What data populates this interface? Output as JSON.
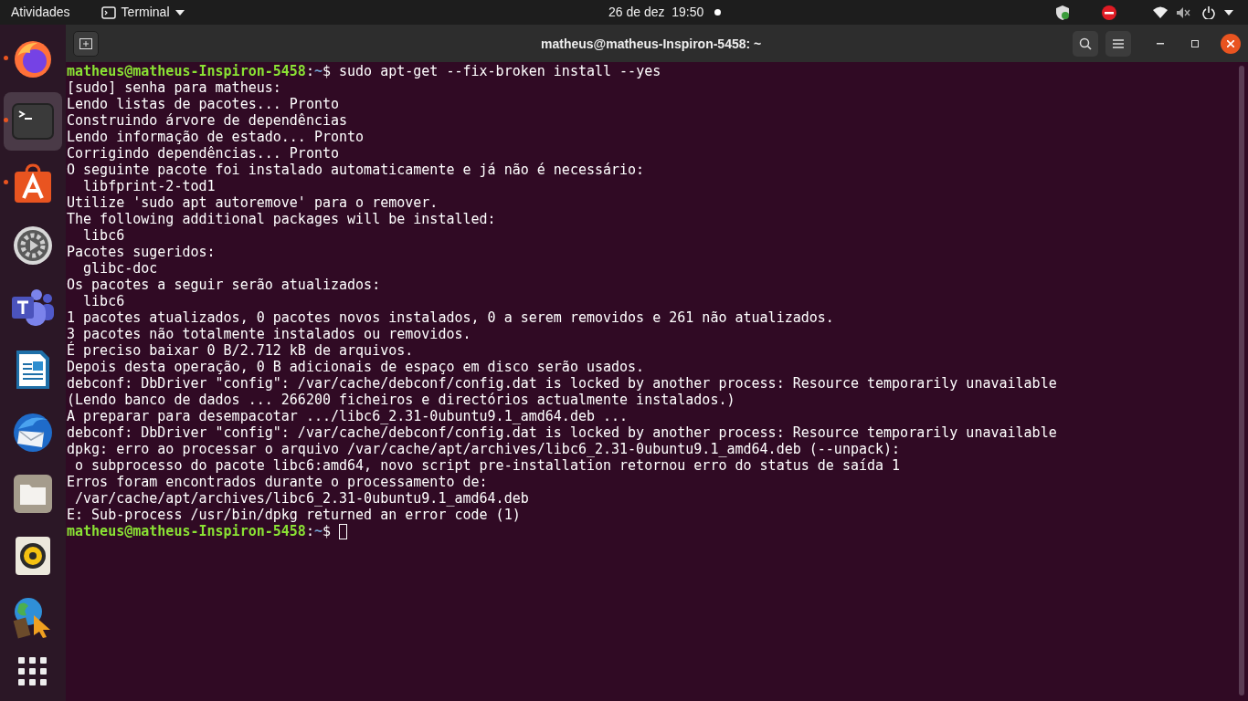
{
  "top_bar": {
    "activities": "Atividades",
    "app_menu": "Terminal",
    "clock": "26 de dez  19:50",
    "notification_dot": true
  },
  "dock": {
    "items": [
      {
        "kind": "firefox",
        "running": true,
        "selected": false
      },
      {
        "kind": "terminal",
        "running": true,
        "selected": true
      },
      {
        "kind": "store",
        "running": true,
        "selected": false
      },
      {
        "kind": "settings",
        "running": false,
        "selected": false
      },
      {
        "kind": "teams",
        "running": false,
        "selected": false
      },
      {
        "kind": "writer",
        "running": false,
        "selected": false
      },
      {
        "kind": "mail",
        "running": false,
        "selected": false
      },
      {
        "kind": "files",
        "running": false,
        "selected": false
      },
      {
        "kind": "speaker",
        "running": false,
        "selected": false
      },
      {
        "kind": "globe",
        "running": false,
        "selected": false
      }
    ]
  },
  "window": {
    "title": "matheus@matheus-Inspiron-5458: ~"
  },
  "terminal": {
    "lines": [
      {
        "kind": "prompt",
        "user": "matheus@matheus-Inspiron-5458",
        "sep": ":",
        "path": "~",
        "symbol": "$",
        "command": " sudo apt-get --fix-broken install --yes",
        "cursor": false
      },
      {
        "kind": "output",
        "text": "[sudo] senha para matheus:"
      },
      {
        "kind": "output",
        "text": "Lendo listas de pacotes... Pronto"
      },
      {
        "kind": "output",
        "text": "Construindo árvore de dependências"
      },
      {
        "kind": "output",
        "text": "Lendo informação de estado... Pronto"
      },
      {
        "kind": "output",
        "text": "Corrigindo dependências... Pronto"
      },
      {
        "kind": "output",
        "text": "O seguinte pacote foi instalado automaticamente e já não é necessário:"
      },
      {
        "kind": "output",
        "text": "  libfprint-2-tod1"
      },
      {
        "kind": "output",
        "text": "Utilize 'sudo apt autoremove' para o remover."
      },
      {
        "kind": "output",
        "text": "The following additional packages will be installed:"
      },
      {
        "kind": "output",
        "text": "  libc6"
      },
      {
        "kind": "output",
        "text": "Pacotes sugeridos:"
      },
      {
        "kind": "output",
        "text": "  glibc-doc"
      },
      {
        "kind": "output",
        "text": "Os pacotes a seguir serão atualizados:"
      },
      {
        "kind": "output",
        "text": "  libc6"
      },
      {
        "kind": "output",
        "text": "1 pacotes atualizados, 0 pacotes novos instalados, 0 a serem removidos e 261 não atualizados."
      },
      {
        "kind": "output",
        "text": "3 pacotes não totalmente instalados ou removidos."
      },
      {
        "kind": "output",
        "text": "É preciso baixar 0 B/2.712 kB de arquivos."
      },
      {
        "kind": "output",
        "text": "Depois desta operação, 0 B adicionais de espaço em disco serão usados."
      },
      {
        "kind": "output",
        "text": "debconf: DbDriver \"config\": /var/cache/debconf/config.dat is locked by another process: Resource temporarily unavailable"
      },
      {
        "kind": "output",
        "text": "(Lendo banco de dados ... 266200 ficheiros e directórios actualmente instalados.)"
      },
      {
        "kind": "output",
        "text": "A preparar para desempacotar .../libc6_2.31-0ubuntu9.1_amd64.deb ..."
      },
      {
        "kind": "output",
        "text": "debconf: DbDriver \"config\": /var/cache/debconf/config.dat is locked by another process: Resource temporarily unavailable"
      },
      {
        "kind": "output",
        "text": "dpkg: erro ao processar o arquivo /var/cache/apt/archives/libc6_2.31-0ubuntu9.1_amd64.deb (--unpack):"
      },
      {
        "kind": "output",
        "text": " o subprocesso do pacote libc6:amd64, novo script pre-installation retornou erro do status de saída 1"
      },
      {
        "kind": "output",
        "text": "Erros foram encontrados durante o processamento de:"
      },
      {
        "kind": "output",
        "text": " /var/cache/apt/archives/libc6_2.31-0ubuntu9.1_amd64.deb"
      },
      {
        "kind": "output",
        "text": "E: Sub-process /usr/bin/dpkg returned an error code (1)"
      },
      {
        "kind": "prompt",
        "user": "matheus@matheus-Inspiron-5458",
        "sep": ":",
        "path": "~",
        "symbol": "$",
        "cursor": true
      }
    ]
  }
}
